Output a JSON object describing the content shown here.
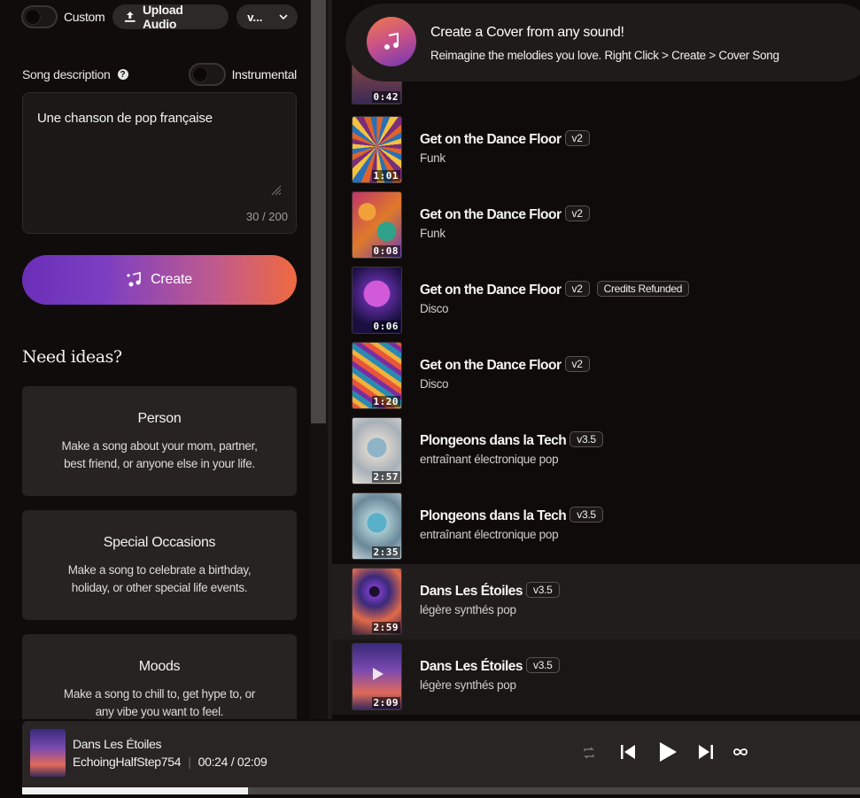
{
  "topbar": {
    "custom_label": "Custom",
    "upload_label": "Upload Audio",
    "version_label": "v..."
  },
  "description": {
    "label": "Song description",
    "instrumental_label": "Instrumental",
    "text": "Une chanson de pop française",
    "char_count": "30 / 200"
  },
  "create_label": "Create",
  "ideas": {
    "title": "Need ideas?",
    "cards": [
      {
        "title": "Person",
        "desc": "Make a song about your mom, partner, best friend, or anyone else in your life."
      },
      {
        "title": "Special Occasions",
        "desc": "Make a song to celebrate a birthday, holiday, or other special life events."
      },
      {
        "title": "Moods",
        "desc": "Make a song to chill to, get hype to, or any vibe you want to feel."
      }
    ]
  },
  "banner": {
    "title": "Create a Cover from any sound!",
    "subtitle": "Reimagine the melodies you love. Right Click > Create > Cover Song"
  },
  "songs": [
    {
      "title": "",
      "genre": "",
      "version": "",
      "duration": "0:42",
      "extra_badge": ""
    },
    {
      "title": "Get on the Dance Floor",
      "genre": "Funk",
      "version": "v2",
      "duration": "1:01",
      "extra_badge": ""
    },
    {
      "title": "Get on the Dance Floor",
      "genre": "Funk",
      "version": "v2",
      "duration": "0:08",
      "extra_badge": ""
    },
    {
      "title": "Get on the Dance Floor",
      "genre": "Disco",
      "version": "v2",
      "duration": "0:06",
      "extra_badge": "Credits Refunded"
    },
    {
      "title": "Get on the Dance Floor",
      "genre": "Disco",
      "version": "v2",
      "duration": "1:20",
      "extra_badge": ""
    },
    {
      "title": "Plongeons dans la Tech",
      "genre": "entraînant électronique pop",
      "version": "v3.5",
      "duration": "2:57",
      "extra_badge": ""
    },
    {
      "title": "Plongeons dans la Tech",
      "genre": "entraînant électronique pop",
      "version": "v3.5",
      "duration": "2:35",
      "extra_badge": ""
    },
    {
      "title": "Dans Les Étoiles",
      "genre": "légère synthés pop",
      "version": "v3.5",
      "duration": "2:59",
      "extra_badge": ""
    },
    {
      "title": "Dans Les Étoiles",
      "genre": "légère synthés pop",
      "version": "v3.5",
      "duration": "2:09",
      "extra_badge": ""
    }
  ],
  "player": {
    "title": "Dans Les Étoiles",
    "artist": "EchoingHalfStep754",
    "time": "00:24 / 02:09",
    "progress": 0.27
  },
  "colors": {
    "accent_start": "#6b2fb8",
    "accent_end": "#ef6a3f"
  },
  "icons": [
    "upload-icon",
    "chevron-down-icon",
    "help-icon",
    "music-note-icon",
    "resize-handle-icon",
    "repeat-icon",
    "previous-icon",
    "play-icon",
    "next-icon",
    "loop-icon"
  ]
}
